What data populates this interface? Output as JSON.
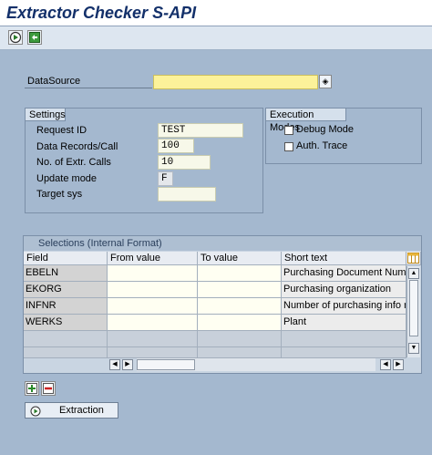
{
  "window": {
    "title": "Extractor Checker S-API"
  },
  "toolbar": {
    "buttons": [
      {
        "icon": "execute-icon"
      },
      {
        "icon": "save-variant-icon"
      }
    ]
  },
  "datasource": {
    "label": "DataSource",
    "value": ""
  },
  "settings": {
    "title": "Settings",
    "fields": [
      {
        "label": "Request ID",
        "value": "TEST"
      },
      {
        "label": "Data Records/Call",
        "value": "100"
      },
      {
        "label": "No. of Extr. Calls",
        "value": "10"
      },
      {
        "label": "Update mode",
        "value": "F"
      },
      {
        "label": "Target sys",
        "value": ""
      }
    ]
  },
  "execution": {
    "title": "Execution Modes",
    "options": [
      {
        "label": "Debug Mode",
        "checked": false
      },
      {
        "label": "Auth. Trace",
        "checked": false
      }
    ]
  },
  "selections": {
    "title": "Selections (Internal Format)",
    "columns": [
      "Field",
      "From value",
      "To value",
      "Short text"
    ],
    "rows": [
      {
        "field": "EBELN",
        "from": "",
        "to": "",
        "text": "Purchasing Document Numb"
      },
      {
        "field": "EKORG",
        "from": "",
        "to": "",
        "text": "Purchasing organization"
      },
      {
        "field": "INFNR",
        "from": "",
        "to": "",
        "text": "Number of purchasing info re"
      },
      {
        "field": "WERKS",
        "from": "",
        "to": "",
        "text": "Plant"
      }
    ]
  },
  "actions": {
    "extraction_label": "Extraction"
  },
  "colors": {
    "background": "#a4b8cf",
    "title": "#13306a",
    "input": "#f7f8e9",
    "datasource_input": "#fcf29a"
  }
}
